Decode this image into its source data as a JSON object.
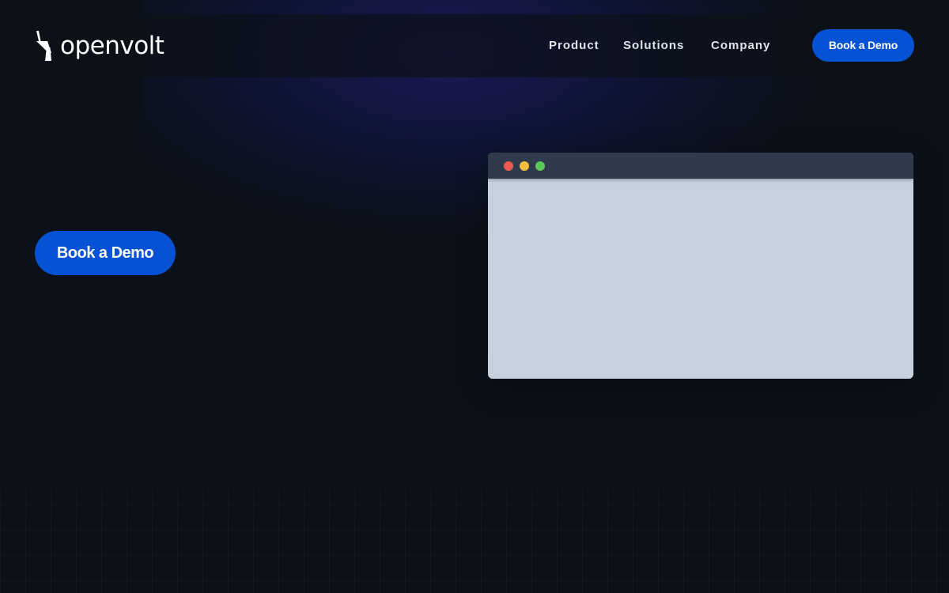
{
  "brand": {
    "name": "openvolt",
    "logo_icon": "lightning-bolt-icon"
  },
  "nav": {
    "items": [
      {
        "label": "Product"
      },
      {
        "label": "Solutions"
      },
      {
        "label": "Company"
      }
    ],
    "cta_label": "Book a Demo"
  },
  "hero": {
    "cta_label": "Book a Demo"
  },
  "browser_mock": {
    "window_controls": [
      {
        "name": "close",
        "color": "#ee5a52"
      },
      {
        "name": "minimize",
        "color": "#f5be3b"
      },
      {
        "name": "maximize",
        "color": "#5bc85a"
      }
    ]
  },
  "colors": {
    "background": "#0c1018",
    "primary": "#0552d4",
    "mock_titlebar": "#2f3a4d",
    "mock_body": "#c7d0dd"
  }
}
